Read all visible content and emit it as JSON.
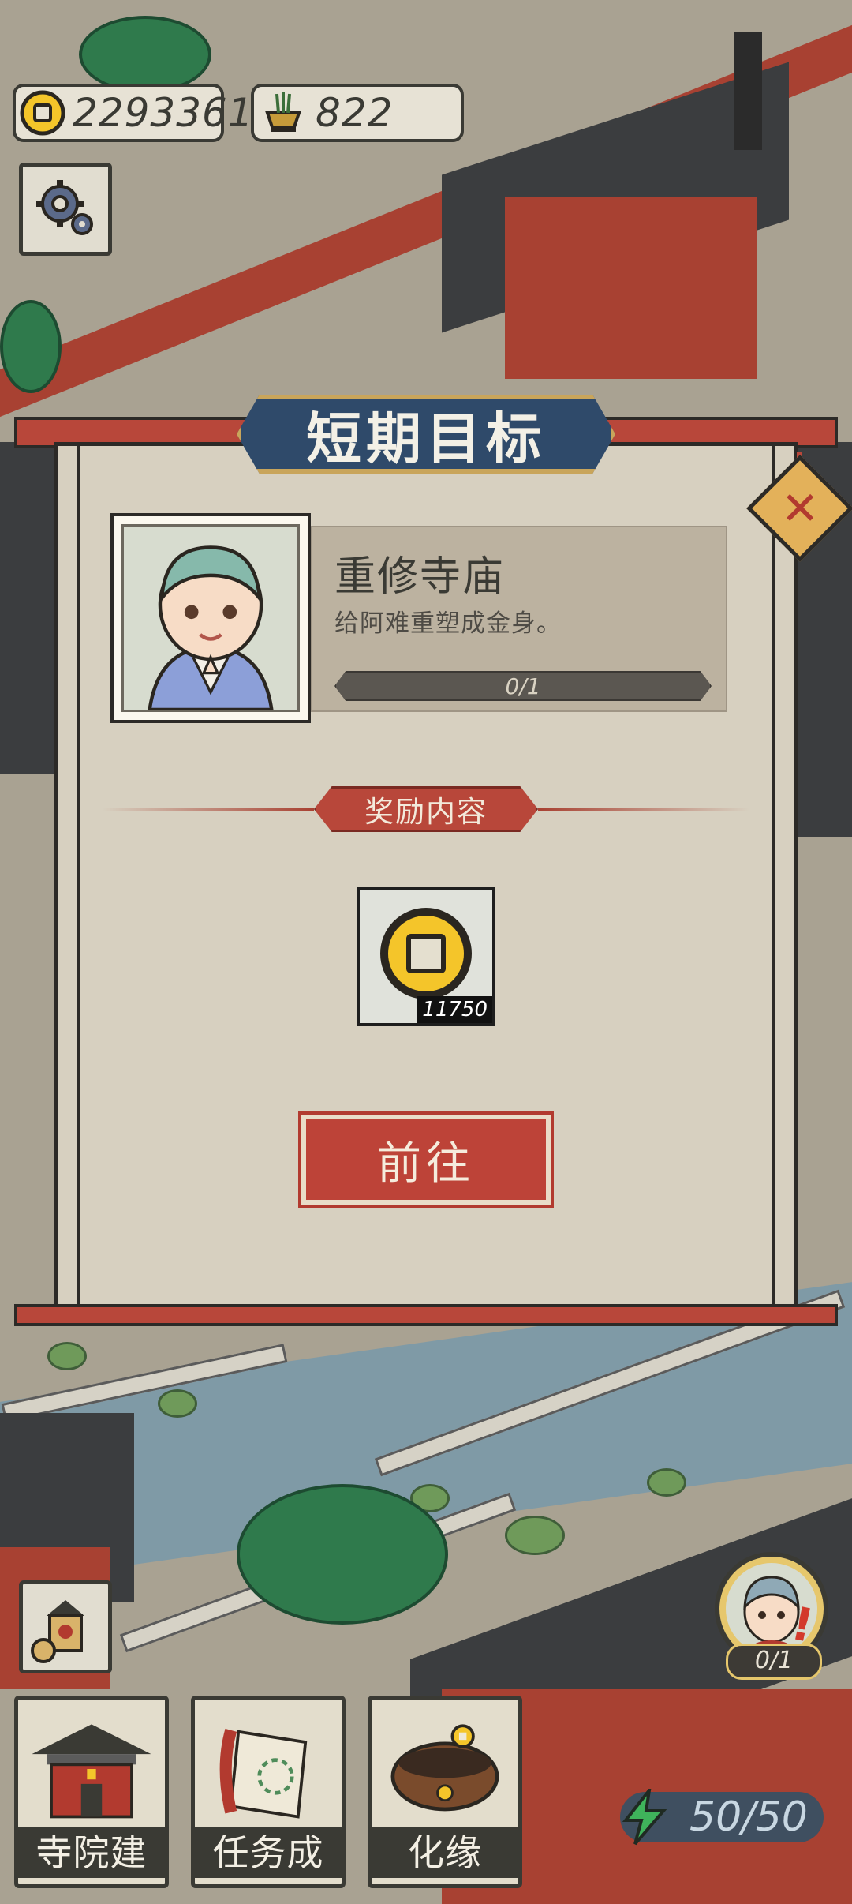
{
  "hud": {
    "coins": "2293361",
    "coin_icon": "coin-icon",
    "incense": "822",
    "incense_icon": "incense-burner-icon",
    "settings_icon": "gear-icon"
  },
  "dialog": {
    "title": "短期目标",
    "close_icon": "close-icon",
    "goal": {
      "title": "重修寺庙",
      "description": "给阿难重塑成金身。",
      "progress_text": "0/1",
      "progress_fraction": 0
    },
    "reward_section_label": "奖励内容",
    "reward": {
      "icon": "coin-icon",
      "quantity": "11750"
    },
    "go_button_label": "前往"
  },
  "bottom_nav": [
    {
      "label": "寺院建设",
      "icon": "temple-icon"
    },
    {
      "label": "任务成就",
      "icon": "scroll-book-icon"
    },
    {
      "label": "化缘",
      "icon": "alms-bowl-icon"
    }
  ],
  "monk_badge": {
    "count": "0/1",
    "icon": "monk-avatar-icon",
    "alert_icon": "exclamation-icon"
  },
  "energy": {
    "value": "50/50",
    "icon": "lightning-icon"
  },
  "colors": {
    "dialog_bg": "#d7d0c0",
    "accent_red": "#b8473a",
    "title_blue": "#2f4a6a",
    "gold": "#f4c52a"
  }
}
